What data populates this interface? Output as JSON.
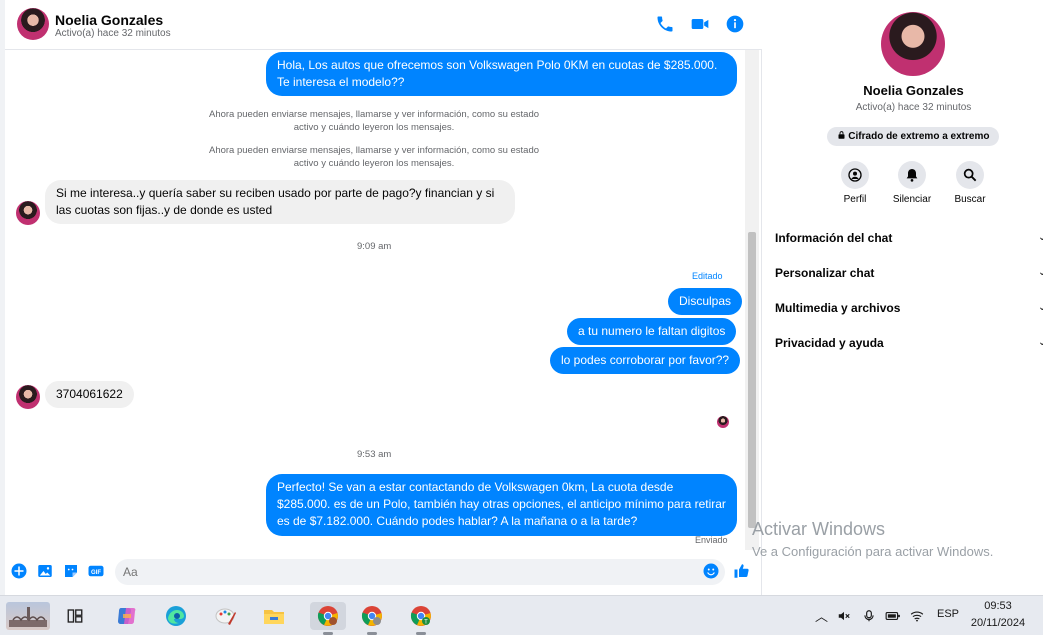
{
  "contact": {
    "name": "Noelia Gonzales",
    "status": "Activo(a) hace 32 minutos"
  },
  "header_icons": [
    "phone-icon",
    "video-icon",
    "info-icon"
  ],
  "messages": {
    "m1": "Hola, Los autos que ofrecemos son Volkswagen Polo 0KM en cuotas de $285.000. Te interesa el modelo??",
    "sys1": "Ahora pueden enviarse mensajes, llamarse y ver información, como su estado activo y cuándo leyeron los mensajes.",
    "sys2": "Ahora pueden enviarse mensajes, llamarse y ver información, como su estado activo y cuándo leyeron los mensajes.",
    "m2": "Si me interesa..y quería saber su reciben usado por parte de pago?y financian y si las cuotas son fijas..y de donde es usted",
    "time1": "9:09 am",
    "edited": "Editado",
    "m3": "Disculpas",
    "m4": "a tu numero le faltan digitos",
    "m5": "lo podes corroborar por favor??",
    "m6": "3704061622",
    "time2": "9:53 am",
    "m7": "Perfecto!  Se van a estar contactando de Volkswagen 0km, La cuota desde $285.000. es de un Polo, también hay otras opciones, el anticipo mínimo para retirar es de $7.182.000. Cuándo podes hablar? A la mañana o a la tarde?",
    "sent": "Enviado"
  },
  "composer": {
    "placeholder": "Aa",
    "icons": [
      "plus-icon",
      "photo-icon",
      "sticker-icon",
      "gif-icon",
      "emoji-icon",
      "like-icon"
    ]
  },
  "info_panel": {
    "encryption": "Cifrado de extremo a extremo",
    "actions": [
      {
        "label": "Perfil",
        "icon": "profile-icon"
      },
      {
        "label": "Silenciar",
        "icon": "bell-icon"
      },
      {
        "label": "Buscar",
        "icon": "search-icon"
      }
    ],
    "sections": [
      "Información del chat",
      "Personalizar chat",
      "Multimedia y archivos",
      "Privacidad y ayuda"
    ]
  },
  "watermark": {
    "title": "Activar Windows",
    "subtitle": "Ve a Configuración para activar Windows."
  },
  "taskbar": {
    "lang": "ESP",
    "time": "09:53",
    "date": "20/11/2024"
  },
  "colors": {
    "accent": "#0084ff",
    "incoming_bubble": "#f0f0f0"
  }
}
